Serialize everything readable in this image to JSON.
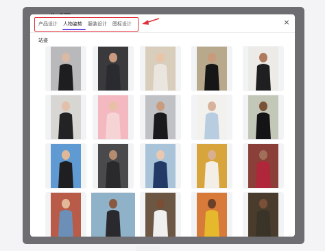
{
  "background_window": {
    "title": "AI 生成图"
  },
  "dialog": {
    "tabs": [
      {
        "label": "产品设计",
        "active": false
      },
      {
        "label": "人物姿势",
        "active": true
      },
      {
        "label": "服装设计",
        "active": false
      },
      {
        "label": "图标设计",
        "active": false
      }
    ],
    "close_icon": "×",
    "section_title": "站姿"
  },
  "colors": {
    "accent": "#6c4fe8",
    "annotation": "#e0303a",
    "overlay": "#6e6e72"
  },
  "gallery": [
    {
      "name": "woman-black-outfit-pose",
      "bg": "#b9b9bc",
      "fg": "#1e1e20",
      "skin": "#d9b8a4"
    },
    {
      "name": "man-holding-baby",
      "bg": "#3a3a3c",
      "fg": "#2a2b30",
      "skin": "#c99a80"
    },
    {
      "name": "woman-blonde-white-outfit",
      "bg": "#d9cdbb",
      "fg": "#eae6df",
      "skin": "#e8c4a8"
    },
    {
      "name": "woman-black-dress-stairs",
      "bg": "#b8a98c",
      "fg": "#161616",
      "skin": "#c99a7c"
    },
    {
      "name": "man-beard-black-shirt",
      "bg": "#ecebe8",
      "fg": "#1f1f22",
      "skin": "#b07a5c"
    },
    {
      "name": "woman-with-laptop",
      "bg": "#d8d6d2",
      "fg": "#232325",
      "skin": "#e2c0aa"
    },
    {
      "name": "woman-pink-background",
      "bg": "#f4b9c0",
      "fg": "#f6d4d6",
      "skin": "#e7c0a6"
    },
    {
      "name": "man-black-suit-walking",
      "bg": "#bfc1c4",
      "fg": "#1a1a1c",
      "skin": "#c99c80"
    },
    {
      "name": "woman-denim-jacket",
      "bg": "#f3f1ee",
      "fg": "#b9cde0",
      "skin": "#d8b39c"
    },
    {
      "name": "man-black-hoodie-outdoors",
      "bg": "#c2c7b8",
      "fg": "#141416",
      "skin": "#7a5238"
    },
    {
      "name": "woman-sky-background",
      "bg": "#5f9ad3",
      "fg": "#1f1f22",
      "skin": "#e0b898"
    },
    {
      "name": "man-dark-coat",
      "bg": "#4a4a4c",
      "fg": "#2a2a2c",
      "skin": "#b58c70"
    },
    {
      "name": "woman-red-hair-floral",
      "bg": "#a9c4d9",
      "fg": "#233a66",
      "skin": "#e8c8b0"
    },
    {
      "name": "wedding-couple",
      "bg": "#d8a53c",
      "fg": "#f3efe6",
      "skin": "#d8b090"
    },
    {
      "name": "traditional-wedding-couple",
      "bg": "#8a3f38",
      "fg": "#b0263a",
      "skin": "#a0705a"
    },
    {
      "name": "couple-embracing",
      "bg": "#b85b48",
      "fg": "#6c8fb8",
      "skin": "#e2b898"
    },
    {
      "name": "group-selfie",
      "bg": "#8fb2c8",
      "fg": "#2a2a2e",
      "skin": "#8a5a40"
    },
    {
      "name": "man-white-shirt-studio",
      "bg": "#6b5744",
      "fg": "#efefef",
      "skin": "#7a4e34"
    },
    {
      "name": "man-yellow-shirt-arms-up",
      "bg": "#d77a3a",
      "fg": "#e6b82c",
      "skin": "#6a4028"
    },
    {
      "name": "man-with-backpack",
      "bg": "#4a3c2c",
      "fg": "#3a3328",
      "skin": "#7a5038"
    }
  ]
}
